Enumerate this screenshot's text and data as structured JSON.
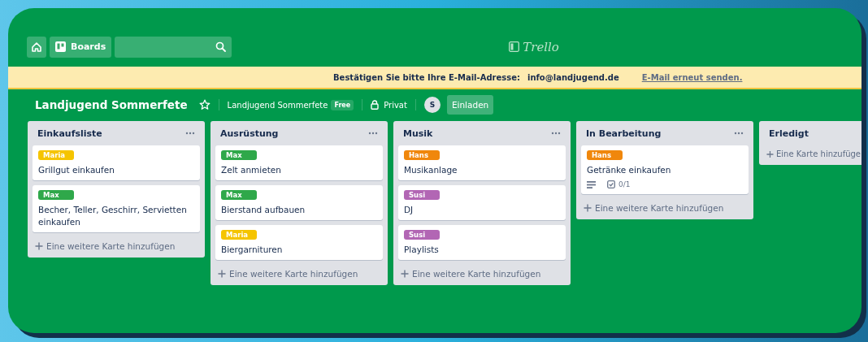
{
  "top_bar": {
    "boards_button": "Boards",
    "logo": "Trello"
  },
  "banner": {
    "message": "Bestätigen Sie bitte Ihre E-Mail-Adresse:",
    "email": "info@landjugend.de",
    "link": "E-Mail erneut senden."
  },
  "board_header": {
    "title": "Landjugend Sommerfete",
    "starred": false,
    "team": "Landjugend Sommerfete",
    "team_badge": "Free",
    "visibility": "Privat",
    "avatar": "S",
    "invite_button": "Einladen"
  },
  "lists": [
    {
      "title": "Einkaufsliste",
      "add_card": "Eine weitere Karte hinzufügen",
      "cards": [
        {
          "label": {
            "text": "Maria",
            "color": "#f5c400"
          },
          "title": "Grillgut einkaufen"
        },
        {
          "label": {
            "text": "Max",
            "color": "#2fa84a"
          },
          "title": "Becher, Teller, Geschirr, Servietten einkaufen"
        }
      ]
    },
    {
      "title": "Ausrüstung",
      "add_card": "Eine weitere Karte hinzufügen",
      "cards": [
        {
          "label": {
            "text": "Max",
            "color": "#2fa84a"
          },
          "title": "Zelt anmieten"
        },
        {
          "label": {
            "text": "Max",
            "color": "#2fa84a"
          },
          "title": "Bierstand aufbauen"
        },
        {
          "label": {
            "text": "Maria",
            "color": "#f5c400"
          },
          "title": "Biergarnituren"
        }
      ]
    },
    {
      "title": "Musik",
      "add_card": "Eine weitere Karte hinzufügen",
      "cards": [
        {
          "label": {
            "text": "Hans",
            "color": "#f0870c"
          },
          "title": "Musikanlage"
        },
        {
          "label": {
            "text": "Susi",
            "color": "#b266b4"
          },
          "title": "DJ"
        },
        {
          "label": {
            "text": "Susi",
            "color": "#b266b4"
          },
          "title": "Playlists"
        }
      ]
    },
    {
      "title": "In Bearbeitung",
      "add_card": "Eine weitere Karte hinzufügen",
      "cards": [
        {
          "label": {
            "text": "Hans",
            "color": "#f0870c"
          },
          "title": "Getränke einkaufen",
          "has_description": true,
          "checklist": "0/1"
        }
      ]
    },
    {
      "title": "Erledigt",
      "add_card": "Eine Karte hinzufüge"
    }
  ]
}
